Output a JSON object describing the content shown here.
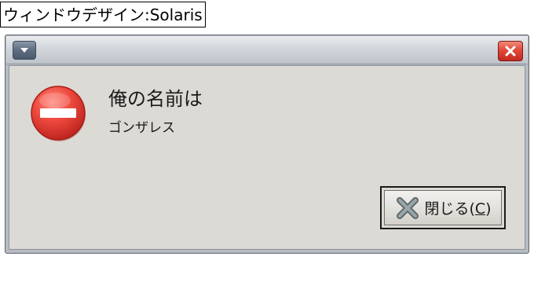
{
  "caption": {
    "text": "ウィンドウデザイン:Solaris"
  },
  "window": {
    "menu_icon": "window-menu-arrow-icon",
    "close_icon": "close-icon"
  },
  "dialog": {
    "icon": "stop-error-icon",
    "heading": "俺の名前は",
    "message": "ゴンザレス"
  },
  "close_button": {
    "icon": "close-x-icon",
    "label_prefix": "閉じる(",
    "mnemonic": "C",
    "label_suffix": ")"
  },
  "colors": {
    "dialog_background": "#dcdad5",
    "error_red": "#e23a35",
    "close_button_red": "#d63a2c",
    "titlebar": "#d2d6db"
  }
}
